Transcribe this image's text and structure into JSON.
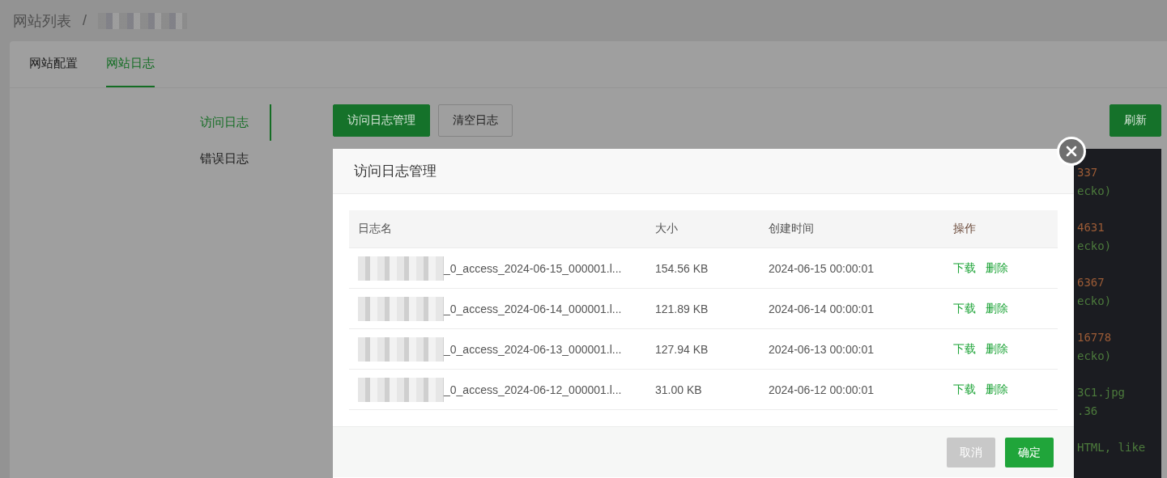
{
  "breadcrumb": {
    "root": "网站列表",
    "separator": "/"
  },
  "tabs": [
    {
      "label": "网站配置",
      "selected": false
    },
    {
      "label": "网站日志",
      "selected": true
    }
  ],
  "side_menu": [
    {
      "label": "访问日志",
      "selected": true
    },
    {
      "label": "错误日志",
      "selected": false
    }
  ],
  "toolbar": [
    {
      "label": "访问日志管理",
      "kind": "primary"
    },
    {
      "label": "清空日志",
      "kind": "default"
    }
  ],
  "refresh_button": "刷新",
  "log_panel": [
    {
      "lines": [
        {
          "text": "337",
          "kind": "number"
        },
        {
          "text": "ecko)",
          "kind": "text"
        }
      ]
    },
    {
      "lines": [
        {
          "text": "4631",
          "kind": "number"
        },
        {
          "text": "ecko)",
          "kind": "text"
        }
      ]
    },
    {
      "lines": [
        {
          "text": "6367",
          "kind": "number"
        },
        {
          "text": "ecko)",
          "kind": "text"
        }
      ]
    },
    {
      "lines": [
        {
          "text": "16778",
          "kind": "number"
        },
        {
          "text": "ecko)",
          "kind": "text"
        }
      ]
    },
    {
      "lines": [
        {
          "text": "3C1.jpg",
          "kind": "text"
        },
        {
          "text": ".36",
          "kind": "text"
        }
      ]
    },
    {
      "lines": [
        {
          "text": "HTML, like",
          "kind": "text"
        }
      ]
    }
  ],
  "modal": {
    "title": "访问日志管理",
    "columns": [
      "日志名",
      "大小",
      "创建时间",
      "操作"
    ],
    "rows": [
      {
        "name": "_0_access_2024-06-15_000001.l...",
        "size": "154.56 KB",
        "created": "2024-06-15 00:00:01",
        "actions": [
          "下载",
          "删除"
        ]
      },
      {
        "name": "_0_access_2024-06-14_000001.l...",
        "size": "121.89 KB",
        "created": "2024-06-14 00:00:01",
        "actions": [
          "下载",
          "删除"
        ]
      },
      {
        "name": "_0_access_2024-06-13_000001.l...",
        "size": "127.94 KB",
        "created": "2024-06-13 00:00:01",
        "actions": [
          "下载",
          "删除"
        ]
      },
      {
        "name": "_0_access_2024-06-12_000001.l...",
        "size": "31.00 KB",
        "created": "2024-06-12 00:00:01",
        "actions": [
          "下载",
          "删除"
        ]
      }
    ],
    "buttons": [
      {
        "label": "取消",
        "kind": "cancel"
      },
      {
        "label": "确定",
        "kind": "confirm"
      }
    ]
  }
}
